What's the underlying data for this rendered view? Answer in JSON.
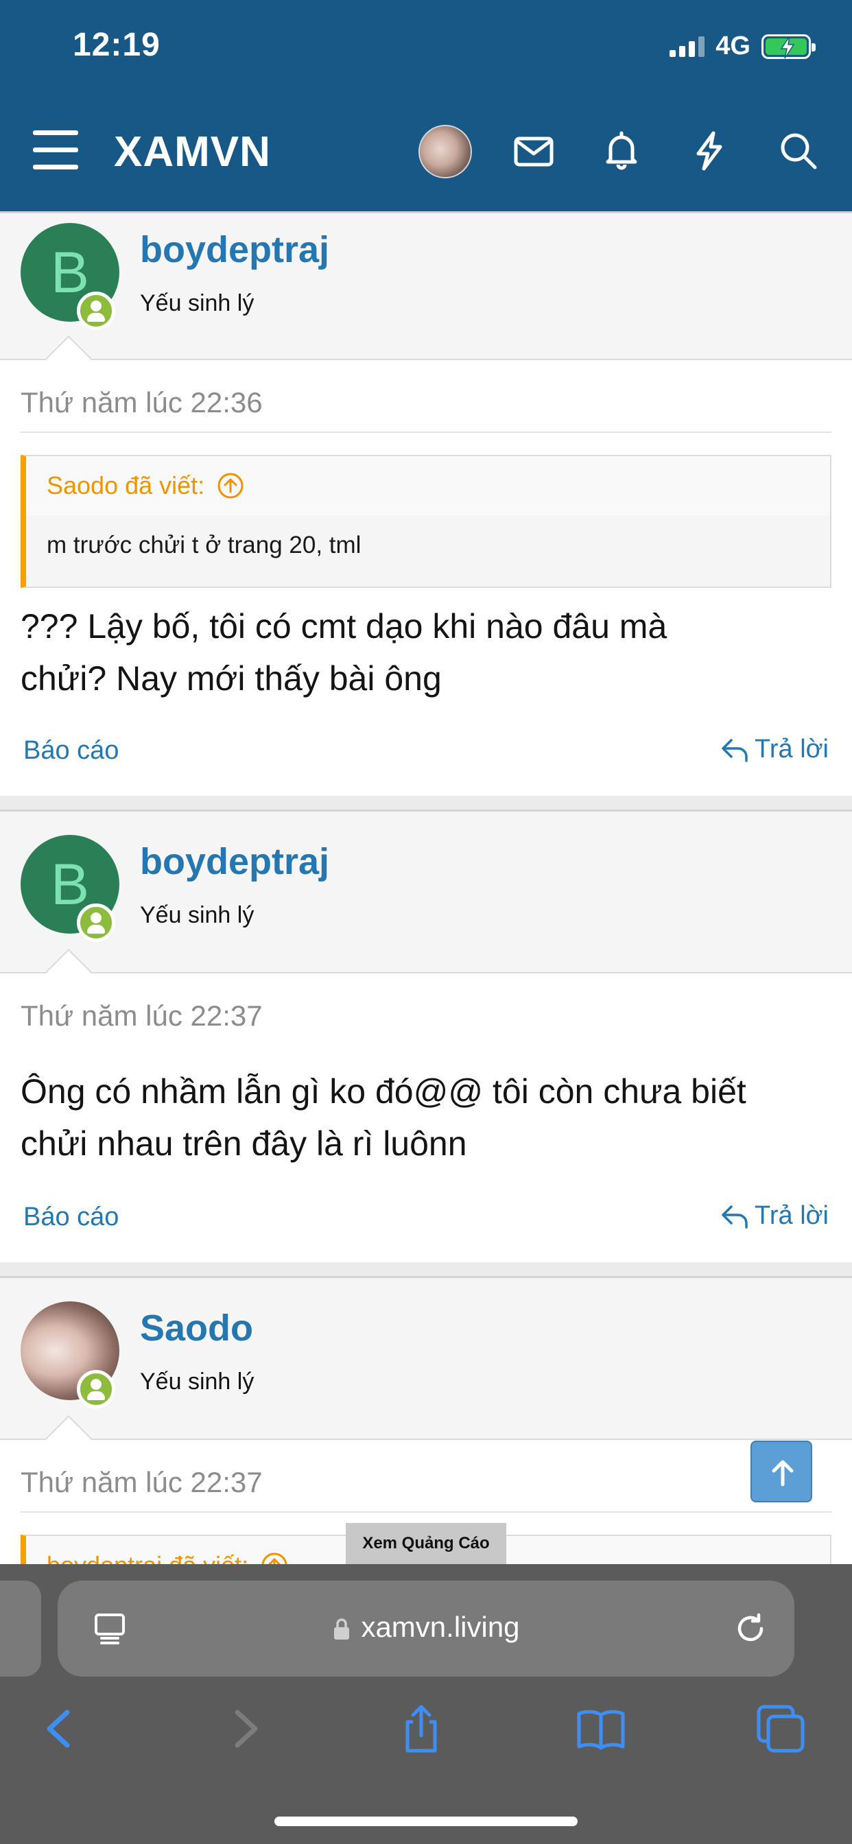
{
  "status_bar": {
    "time": "12:19",
    "network": "4G"
  },
  "header": {
    "site_title": "XAMVN"
  },
  "posts": [
    {
      "username": "boydeptraj",
      "user_title": "Yếu sinh lý",
      "avatar_letter": "B",
      "date": "Thứ năm lúc 22:36",
      "quote_author": "Saodo đã viết:",
      "quote_text": "m trước chửi t ở trang 20, tml",
      "content_line1": "??? Lậy bố, tôi có cmt dạo khi nào đâu mà",
      "content_line2": "chửi? Nay mới thấy bài ông",
      "report_label": "Báo cáo",
      "reply_label": "Trả lời"
    },
    {
      "username": "boydeptraj",
      "user_title": "Yếu sinh lý",
      "avatar_letter": "B",
      "date": "Thứ năm lúc 22:37",
      "content_line1": "Ông có nhầm lẫn gì ko đó@@ tôi còn chưa biết",
      "content_line2": "chửi nhau trên đây là rì luônn",
      "report_label": "Báo cáo",
      "reply_label": "Trả lời"
    },
    {
      "username": "Saodo",
      "user_title": "Yếu sinh lý",
      "date": "Thứ năm lúc 22:37",
      "quote_author": "boydeptraj đã viết:"
    }
  ],
  "ad_label": "Xem Quảng Cáo",
  "browser": {
    "url": "xamvn.living"
  },
  "colors": {
    "header_bg": "#185886",
    "link": "#2577b1",
    "quote_accent": "#f7a000",
    "online": "#8dbb3b"
  }
}
